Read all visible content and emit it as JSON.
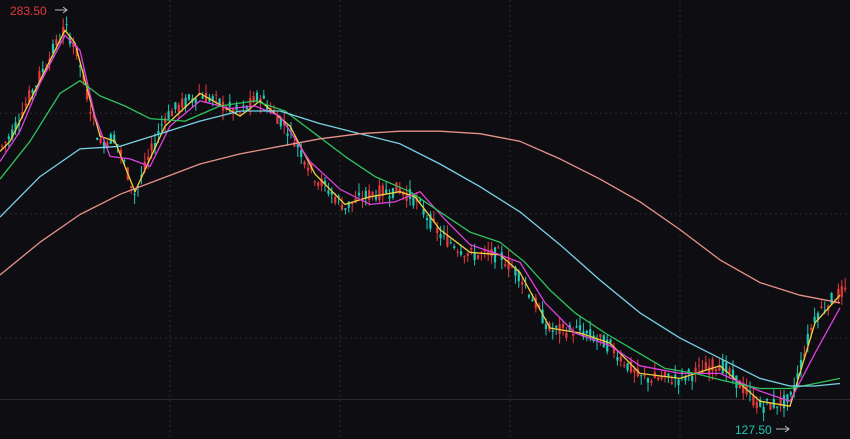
{
  "chart_data": {
    "type": "candlestick",
    "title": "",
    "xlabel": "",
    "ylabel": "",
    "ylim": [
      118,
      292
    ],
    "grid": true,
    "legend": "none",
    "colors": {
      "background": "#0e0e12",
      "grid": "#2a2a30",
      "up": "#e5393b",
      "down": "#1fc9b6",
      "high_label": "#e5393b",
      "low_label": "#1fc9b6"
    },
    "annotations": {
      "max_label": "283.50",
      "min_label": "127.50"
    },
    "series": [
      {
        "type": "line",
        "color": "#ffffff",
        "x": [
          0,
          10,
          40,
          65,
          75,
          85,
          100,
          115,
          135,
          165,
          200,
          240,
          260,
          290,
          315,
          345,
          370,
          400,
          415,
          440,
          470,
          500,
          520,
          550,
          580,
          610,
          640,
          680,
          720,
          760,
          790,
          815,
          840
        ],
        "y": [
          233,
          238,
          262,
          281,
          274,
          258,
          235,
          238,
          215,
          246,
          255,
          247,
          254,
          240,
          222,
          210,
          215,
          217,
          213,
          199,
          191,
          191,
          183,
          161,
          161,
          155,
          142,
          142,
          148,
          131,
          133,
          167,
          176
        ]
      },
      {
        "type": "line",
        "color": "#f0d040",
        "x": [
          0,
          10,
          40,
          65,
          75,
          85,
          100,
          115,
          135,
          165,
          200,
          240,
          260,
          290,
          315,
          345,
          370,
          400,
          415,
          440,
          470,
          500,
          520,
          550,
          580,
          610,
          640,
          680,
          720,
          760,
          790,
          815,
          840
        ],
        "y": [
          232,
          236,
          260,
          280,
          275,
          260,
          238,
          236,
          216,
          242,
          255,
          246,
          252,
          242,
          223,
          211,
          214,
          216,
          214,
          201,
          192,
          191,
          184,
          162,
          160,
          156,
          144,
          142,
          147,
          133,
          131,
          164,
          175
        ]
      },
      {
        "type": "line",
        "color": "#e040e0",
        "x": [
          0,
          20,
          40,
          65,
          80,
          95,
          110,
          130,
          150,
          170,
          200,
          230,
          255,
          280,
          310,
          340,
          370,
          395,
          420,
          445,
          470,
          500,
          520,
          545,
          575,
          610,
          640,
          680,
          720,
          760,
          790,
          815,
          840
        ],
        "y": [
          228,
          240,
          259,
          278,
          272,
          246,
          230,
          229,
          226,
          242,
          252,
          249,
          250,
          246,
          228,
          217,
          211,
          212,
          216,
          205,
          195,
          191,
          188,
          172,
          160,
          155,
          147,
          144,
          144,
          137,
          133,
          152,
          170
        ]
      },
      {
        "type": "line",
        "color": "#2fc25b",
        "x": [
          0,
          30,
          60,
          80,
          100,
          125,
          150,
          185,
          220,
          255,
          285,
          315,
          345,
          375,
          410,
          440,
          470,
          500,
          525,
          550,
          575,
          605,
          635,
          665,
          695,
          725,
          760,
          790,
          815,
          840
        ],
        "y": [
          221,
          236,
          255,
          260,
          254,
          250,
          245,
          244,
          250,
          252,
          248,
          239,
          230,
          222,
          216,
          208,
          200,
          196,
          188,
          177,
          168,
          160,
          153,
          146,
          144,
          141,
          138,
          138,
          140,
          142
        ]
      },
      {
        "type": "line",
        "color": "#7ad2e8",
        "x": [
          0,
          40,
          80,
          120,
          160,
          200,
          240,
          280,
          320,
          360,
          400,
          440,
          480,
          520,
          560,
          600,
          640,
          680,
          720,
          760,
          790,
          815,
          840
        ],
        "y": [
          206,
          222,
          233,
          234,
          239,
          244,
          248,
          248,
          243,
          239,
          235,
          227,
          218,
          208,
          195,
          181,
          168,
          158,
          150,
          142,
          139,
          139,
          140
        ]
      },
      {
        "type": "line",
        "color": "#e8918a",
        "x": [
          0,
          40,
          80,
          120,
          160,
          200,
          240,
          280,
          320,
          360,
          400,
          440,
          480,
          520,
          560,
          600,
          640,
          680,
          720,
          760,
          800,
          840
        ],
        "y": [
          183,
          196,
          207,
          215,
          221,
          227,
          231,
          234,
          237,
          239,
          240,
          240,
          239,
          236,
          229,
          221,
          212,
          201,
          189,
          180,
          175,
          172
        ]
      }
    ]
  }
}
